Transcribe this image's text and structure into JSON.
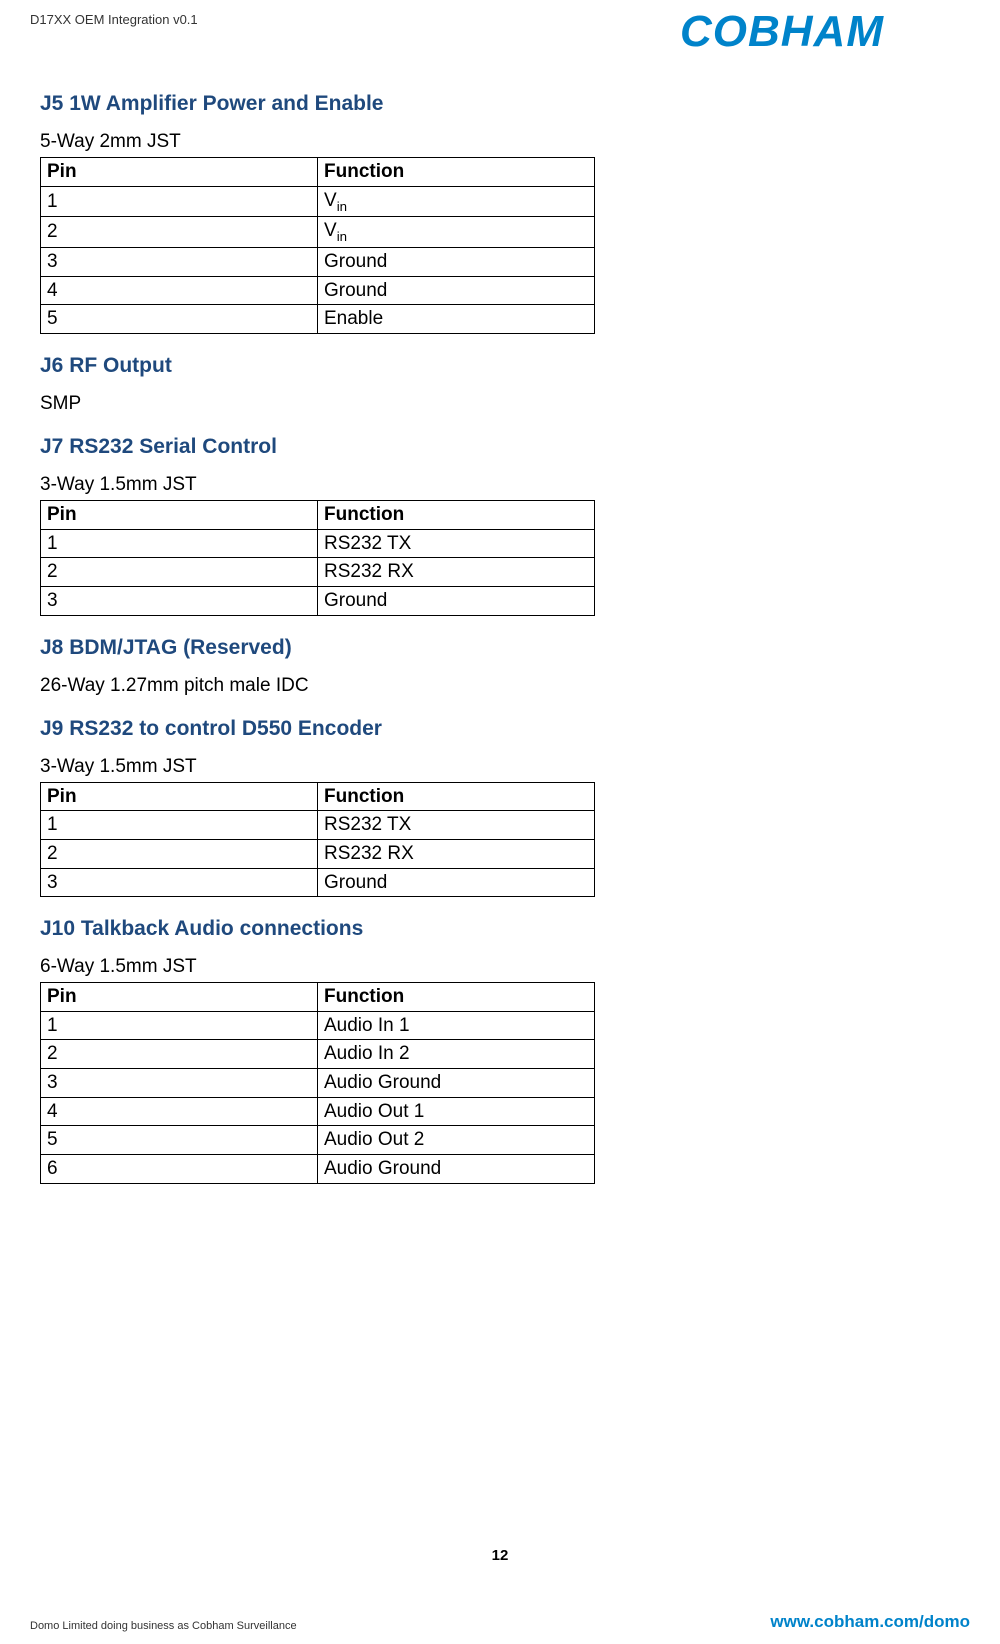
{
  "header": {
    "doc_title": "D17XX OEM Integration v0.1"
  },
  "logo": {
    "brand": "COBHAM"
  },
  "sections": {
    "j5": {
      "heading": "J5 1W Amplifier Power and Enable",
      "subhead": "5-Way 2mm JST",
      "col_pin": "Pin",
      "col_func": "Function",
      "rows": [
        {
          "pin": "1",
          "func_prefix": "V",
          "func_sub": "in"
        },
        {
          "pin": "2",
          "func_prefix": "V",
          "func_sub": "in"
        },
        {
          "pin": "3",
          "func": "Ground"
        },
        {
          "pin": "4",
          "func": "Ground"
        },
        {
          "pin": "5",
          "func": "Enable"
        }
      ]
    },
    "j6": {
      "heading": "J6 RF Output",
      "body": "SMP"
    },
    "j7": {
      "heading": "J7 RS232 Serial Control",
      "subhead": "3-Way 1.5mm JST",
      "col_pin": "Pin",
      "col_func": "Function",
      "rows": [
        {
          "pin": "1",
          "func": "RS232 TX"
        },
        {
          "pin": "2",
          "func": "RS232 RX"
        },
        {
          "pin": "3",
          "func": "Ground"
        }
      ]
    },
    "j8": {
      "heading": "J8 BDM/JTAG (Reserved)",
      "body": "26-Way 1.27mm pitch male IDC"
    },
    "j9": {
      "heading": "J9 RS232 to control D550 Encoder",
      "subhead": "3-Way 1.5mm JST",
      "col_pin": "Pin",
      "col_func": "Function",
      "rows": [
        {
          "pin": "1",
          "func": "RS232 TX"
        },
        {
          "pin": "2",
          "func": "RS232 RX"
        },
        {
          "pin": "3",
          "func": "Ground"
        }
      ]
    },
    "j10": {
      "heading": "J10 Talkback Audio connections",
      "subhead": "6-Way 1.5mm JST",
      "col_pin": "Pin",
      "col_func": "Function",
      "rows": [
        {
          "pin": "1",
          "func": "Audio In 1"
        },
        {
          "pin": "2",
          "func": "Audio In 2"
        },
        {
          "pin": "3",
          "func": "Audio Ground"
        },
        {
          "pin": "4",
          "func": "Audio Out 1"
        },
        {
          "pin": "5",
          "func": "Audio Out 2"
        },
        {
          "pin": "6",
          "func": "Audio Ground"
        }
      ]
    }
  },
  "footer": {
    "page_num": "12",
    "left": "Domo Limited doing business as Cobham Surveillance",
    "right": "www.cobham.com/domo"
  }
}
